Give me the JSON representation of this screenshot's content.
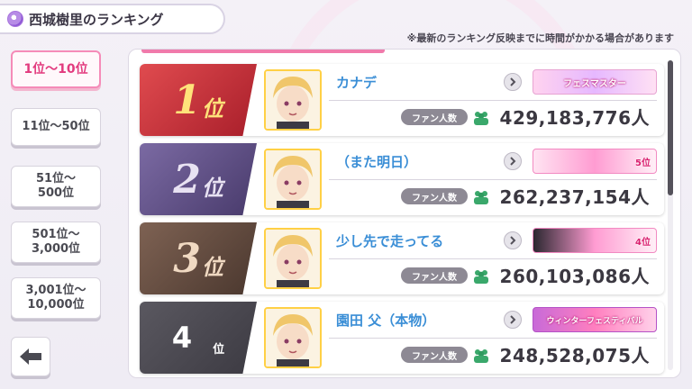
{
  "header": {
    "title": "西城樹里のランキング",
    "notice": "※最新のランキング反映までに時間がかかる場合があります"
  },
  "nav": {
    "tabs": [
      {
        "label_line1": "1位～10位",
        "label_line2": "",
        "active": true
      },
      {
        "label_line1": "11位～50位",
        "label_line2": "",
        "active": false
      },
      {
        "label_line1": "51位～",
        "label_line2": "500位",
        "active": false
      },
      {
        "label_line1": "501位～",
        "label_line2": "3,000位",
        "active": false
      },
      {
        "label_line1": "3,001位～",
        "label_line2": "10,000位",
        "active": false
      }
    ],
    "back_icon": "arrow-left-icon"
  },
  "fan_label": "ファン人数",
  "ranking": [
    {
      "rank": "1",
      "suffix": "位",
      "name": "カナデ",
      "fans": "429,183,776人",
      "banner": "フェスマスター",
      "badge_color": "#c8323a"
    },
    {
      "rank": "2",
      "suffix": "位",
      "name": "（また明日）",
      "fans": "262,237,154人",
      "banner": "5位",
      "badge_color": "#5b4a84"
    },
    {
      "rank": "3",
      "suffix": "位",
      "name": "少し先で走ってる",
      "fans": "260,103,086人",
      "banner": "4位",
      "badge_color": "#5f4a40"
    },
    {
      "rank": "4",
      "suffix": "位",
      "name": "園田 父（本物）",
      "fans": "248,528,075人",
      "banner": "ウィンターフェスティバル",
      "badge_color": "#4b4950"
    }
  ],
  "colors": {
    "accent_pink": "#e23a7e",
    "name_blue": "#3a8ed6",
    "frame_gold": "#ffd045"
  }
}
